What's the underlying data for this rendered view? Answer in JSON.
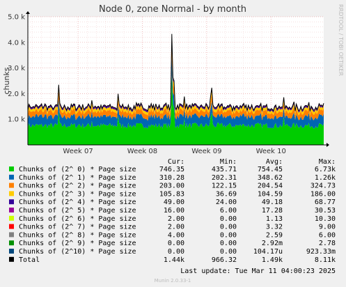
{
  "chart_data": {
    "type": "area",
    "title": "Node 0, zone Normal - by month",
    "ylabel": "chunks",
    "watermark": "RRDTOOL / TOBI OETIKER",
    "footer": "Munin 2.0.33-1",
    "ylim": [
      0,
      5000
    ],
    "y_ticks": [
      {
        "value": 1000,
        "label": "1.0 k"
      },
      {
        "value": 2000,
        "label": "2.0 k"
      },
      {
        "value": 3000,
        "label": "3.0 k"
      },
      {
        "value": 4000,
        "label": "4.0 k"
      },
      {
        "value": 5000,
        "label": "5.0 k"
      }
    ],
    "x_ticks": [
      "Week 07",
      "Week 08",
      "Week 09",
      "Week 10"
    ],
    "grid": true,
    "legend_position": "bottom",
    "columns": {
      "cur": "Cur:",
      "min": "Min:",
      "avg": "Avg:",
      "max": "Max:"
    },
    "last_update": "Last update: Tue Mar 11 04:00:23 2025",
    "series": [
      {
        "name": "Chunks of (2^ 0) * Page size",
        "color": "#00cc00",
        "cur": "746.35",
        "min": "435.71",
        "avg": "754.45",
        "max": "6.73k",
        "base": 754,
        "spike": [
          0,
          0.08,
          0.45,
          0.08,
          0.12,
          0.12,
          0.1,
          0.55
        ]
      },
      {
        "name": "Chunks of (2^ 1) * Page size",
        "color": "#0066b3",
        "cur": "310.28",
        "min": "202.31",
        "avg": "348.62",
        "max": "1.26k",
        "base": 349,
        "spike": [
          0.3,
          0.1,
          0.2,
          0.1,
          0.1,
          0.1,
          0.1,
          0.1
        ]
      },
      {
        "name": "Chunks of (2^ 2) * Page size",
        "color": "#ff8000",
        "cur": "203.00",
        "min": "122.15",
        "avg": "204.54",
        "max": "324.73",
        "base": 205,
        "spike": [
          0.2,
          0.1,
          0.1,
          0.1,
          0.1,
          0.1,
          0.1,
          0.1
        ]
      },
      {
        "name": "Chunks of (2^ 3) * Page size",
        "color": "#ffcc00",
        "cur": "105.83",
        "min": "36.69",
        "avg": "104.59",
        "max": "186.00",
        "base": 105,
        "spike": [
          0.2,
          0.1,
          0.1,
          0.1,
          0.1,
          0.1,
          0.1,
          0.1
        ]
      },
      {
        "name": "Chunks of (2^ 4) * Page size",
        "color": "#330099",
        "cur": "49.00",
        "min": "24.00",
        "avg": "49.18",
        "max": "68.77",
        "base": 49,
        "spike": [
          0.1,
          0.05,
          0.05,
          0.05,
          0.05,
          0.05,
          0.05,
          0.05
        ]
      },
      {
        "name": "Chunks of (2^ 5) * Page size",
        "color": "#990099",
        "cur": "16.00",
        "min": "6.00",
        "avg": "17.28",
        "max": "30.53",
        "base": 17,
        "spike": [
          0,
          0,
          0,
          0,
          0,
          0,
          0,
          0
        ]
      },
      {
        "name": "Chunks of (2^ 6) * Page size",
        "color": "#ccff00",
        "cur": "2.00",
        "min": "0.00",
        "avg": "1.13",
        "max": "10.30",
        "base": 1,
        "spike": [
          0,
          0,
          0,
          0,
          0,
          0,
          0,
          0
        ]
      },
      {
        "name": "Chunks of (2^ 7) * Page size",
        "color": "#ff0000",
        "cur": "2.00",
        "min": "0.00",
        "avg": "3.32",
        "max": "9.00",
        "base": 3,
        "spike": [
          0,
          0,
          0,
          0,
          0,
          0,
          0,
          0
        ]
      },
      {
        "name": "Chunks of (2^ 8) * Page size",
        "color": "#808080",
        "cur": "4.00",
        "min": "0.00",
        "avg": "2.59",
        "max": "6.00",
        "base": 3,
        "spike": [
          0,
          0,
          0,
          0,
          0,
          0,
          0,
          0
        ]
      },
      {
        "name": "Chunks of (2^ 9) * Page size",
        "color": "#008f00",
        "cur": "0.00",
        "min": "0.00",
        "avg": "2.92m",
        "max": "2.78",
        "base": 0,
        "spike": [
          0,
          0,
          0,
          0,
          0,
          0,
          0,
          0
        ]
      },
      {
        "name": "Chunks of (2^10) * Page size",
        "color": "#00487d",
        "cur": "0.00",
        "min": "0.00",
        "avg": "104.17u",
        "max": "923.33m",
        "base": 0,
        "spike": [
          0,
          0,
          0,
          0,
          0,
          0,
          0,
          0
        ]
      }
    ],
    "total": {
      "name": "Total",
      "color": "#000000",
      "cur": "1.44k",
      "min": "966.32",
      "avg": "1.49k",
      "max": "8.11k"
    },
    "total_spikes": [
      {
        "pos": 0.105,
        "value": 2700
      },
      {
        "pos": 0.175,
        "value": 2000
      },
      {
        "pos": 0.215,
        "value": 2200
      },
      {
        "pos": 0.305,
        "value": 2000
      },
      {
        "pos": 0.487,
        "value": 4750
      },
      {
        "pos": 0.49,
        "value": 2800
      },
      {
        "pos": 0.495,
        "value": 2900
      },
      {
        "pos": 0.53,
        "value": 2300
      },
      {
        "pos": 0.62,
        "value": 3100
      },
      {
        "pos": 0.73,
        "value": 1700
      },
      {
        "pos": 0.79,
        "value": 1650
      },
      {
        "pos": 0.865,
        "value": 1900
      },
      {
        "pos": 0.9,
        "value": 1700
      },
      {
        "pos": 0.93,
        "value": 1500
      }
    ]
  }
}
